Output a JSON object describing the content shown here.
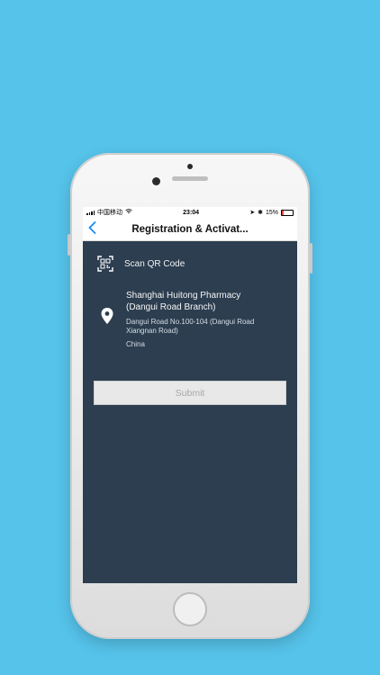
{
  "status_bar": {
    "carrier": "中国移动",
    "time": "23:04",
    "battery": "15%"
  },
  "nav": {
    "back_icon": "chevron-left-icon",
    "title": "Registration & Activat..."
  },
  "scan": {
    "icon": "qr-code-icon",
    "label": "Scan QR Code"
  },
  "store": {
    "icon": "location-pin-icon",
    "name_line1": "Shanghai Huitong Pharmacy",
    "name_line2": "(Dangui Road Branch)",
    "address_line1": "Dangui Road No.100-104 (Dangui Road",
    "address_line2": "Xiangnan Road)",
    "country": "China"
  },
  "submit": {
    "label": "Submit"
  },
  "colors": {
    "background": "#56c3ea",
    "screen": "#2c3e50",
    "accent": "#1a8bf5"
  }
}
